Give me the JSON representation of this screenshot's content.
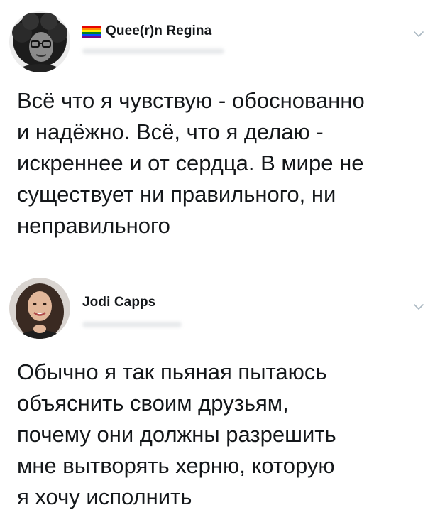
{
  "tweets": [
    {
      "display_name": "Quee(r)n Regina",
      "badge_icon": "rainbow-flag-icon",
      "menu_icon": "chevron-down-icon",
      "text": "Всё что я чувствую - обоснованно\nи надёжно. Всё, что я делаю -\nискреннее и от сердца. В мире не\nсуществует ни правильного, ни\nнеправильного"
    },
    {
      "display_name": "Jodi Capps",
      "menu_icon": "chevron-down-icon",
      "text": "Обычно я так пьяная пытаюсь\nобъяснить своим друзьям,\nпочему они должны разрешить\nмне вытворять херню, которую\nя хочу исполнить"
    }
  ],
  "colors": {
    "text": "#14171a",
    "caret": "#aab8c2",
    "handle_blur": "#e8eaec"
  }
}
